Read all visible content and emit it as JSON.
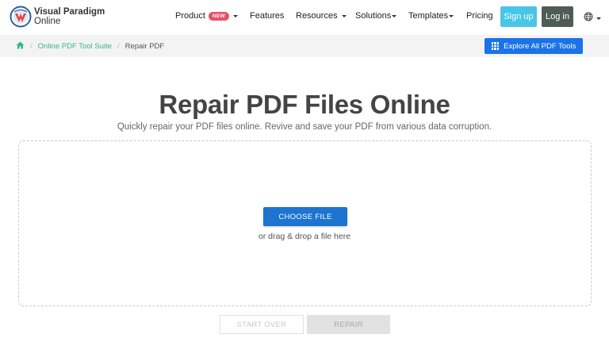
{
  "brand": {
    "line1": "Visual Paradigm",
    "line2": "Online"
  },
  "nav": {
    "product": "Product",
    "new_badge": "NEW",
    "features": "Features",
    "resources": "Resources",
    "solutions": "Solutions",
    "templates": "Templates",
    "pricing": "Pricing",
    "signup": "Sign up",
    "login": "Log in"
  },
  "breadcrumb": {
    "items": [
      "Online PDF Tool Suite",
      "Repair PDF"
    ],
    "explore_label": "Explore All PDF Tools"
  },
  "hero": {
    "title": "Repair PDF Files Online",
    "subtitle": "Quickly repair your PDF files online. Revive and save your PDF from various data corruption."
  },
  "upload": {
    "choose_label": "CHOOSE FILE",
    "drag_text": "or drag & drop a file here"
  },
  "actions": {
    "start_over": "START OVER",
    "repair": "REPAIR"
  },
  "colors": {
    "accent": "#1a73e8",
    "signup": "#48c6e8",
    "login": "#4f5c56",
    "breadcrumb_link": "#3cb38d",
    "new_badge": "#e3536b"
  }
}
